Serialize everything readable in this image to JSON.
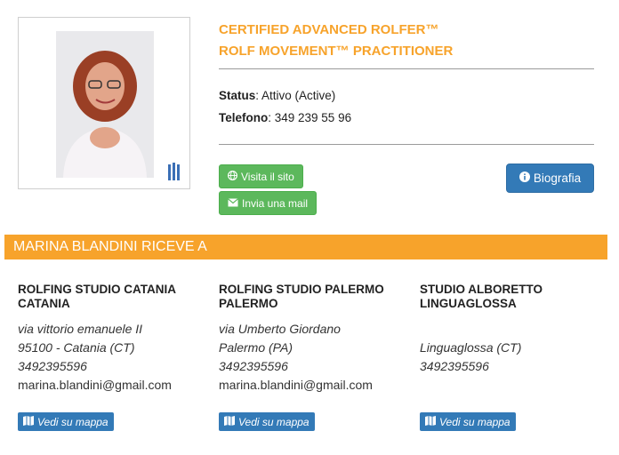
{
  "profile": {
    "titles": [
      "CERTIFIED ADVANCED ROLFER™",
      "ROLF MOVEMENT™ PRACTITIONER"
    ],
    "status_label": "Status",
    "status_value": ": Attivo (Active)",
    "phone_label": "Telefono",
    "phone_value": ": 349 239 55 96"
  },
  "buttons": {
    "website": "Visita il sito",
    "email": "Invia una mail",
    "bio": "Biografia"
  },
  "section": {
    "banner": "MARINA BLANDINI RICEVE A"
  },
  "studios": [
    {
      "name": "ROLFING STUDIO CATANIA CATANIA",
      "address": "via vittorio emanuele II",
      "city": "95100 - Catania (CT)",
      "phone": "3492395596",
      "email": "marina.blandini@gmail.com",
      "map": "Vedi su mappa"
    },
    {
      "name": "ROLFING STUDIO PALERMO PALERMO",
      "address": "via Umberto Giordano",
      "city": "Palermo (PA)",
      "phone": "3492395596",
      "email": "marina.blandini@gmail.com",
      "map": "Vedi su mappa"
    },
    {
      "name": "STUDIO ALBORETTO LINGUAGLOSSA",
      "address": "",
      "city": "Linguaglossa (CT)",
      "phone": "3492395596",
      "email": "",
      "map": "Vedi su mappa"
    }
  ],
  "colors": {
    "accent": "#f7a32b",
    "green": "#5cb85c",
    "blue": "#337ab7"
  },
  "icons": {
    "website": "globe-icon",
    "email": "envelope-icon",
    "bio": "info-circle-icon",
    "map": "map-icon"
  }
}
